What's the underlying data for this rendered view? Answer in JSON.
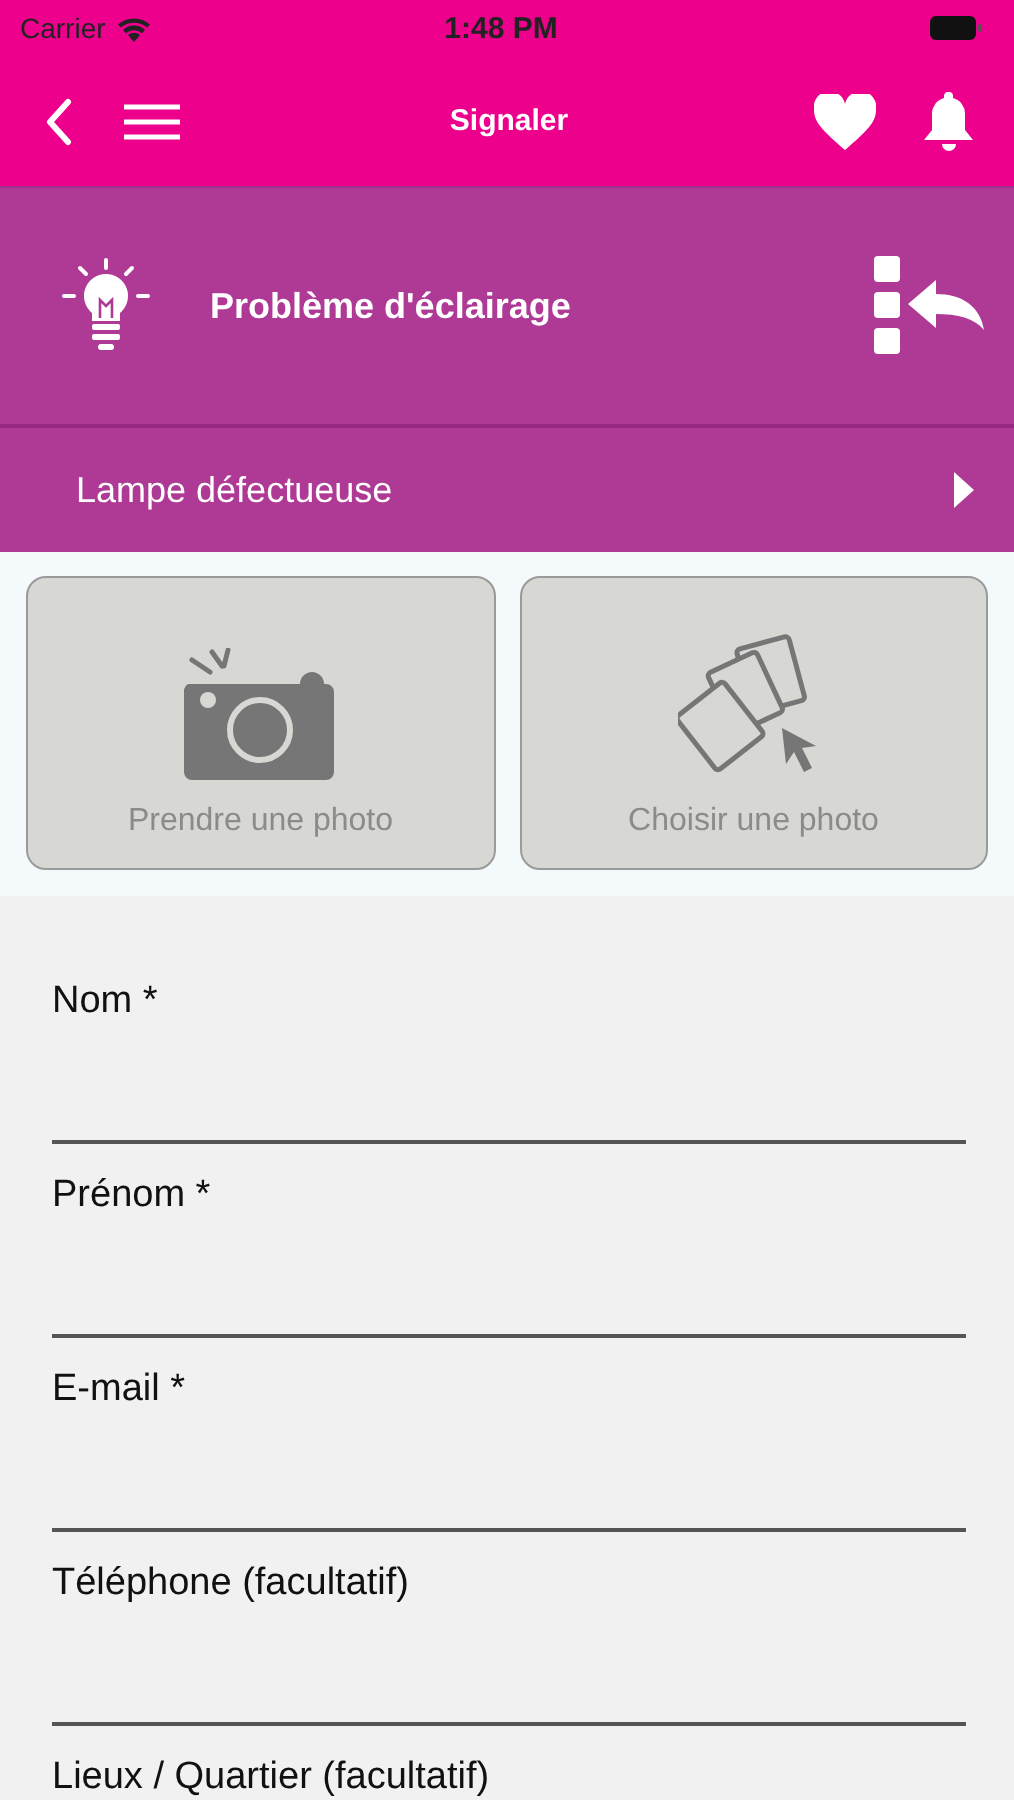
{
  "status_bar": {
    "carrier": "Carrier",
    "time": "1:48 PM"
  },
  "nav": {
    "title": "Signaler"
  },
  "category": {
    "title": "Problème d'éclairage"
  },
  "subcategory": {
    "label": "Lampe défectueuse"
  },
  "photo_buttons": [
    {
      "kind": "camera",
      "label": "Prendre une photo"
    },
    {
      "kind": "gallery",
      "label": "Choisir une photo"
    }
  ],
  "form": {
    "fields": [
      {
        "label": "Nom *"
      },
      {
        "label": "Prénom *"
      },
      {
        "label": "E-mail *"
      },
      {
        "label": "Téléphone (facultatif)"
      },
      {
        "label": "Lieux / Quartier (facultatif)"
      }
    ]
  }
}
